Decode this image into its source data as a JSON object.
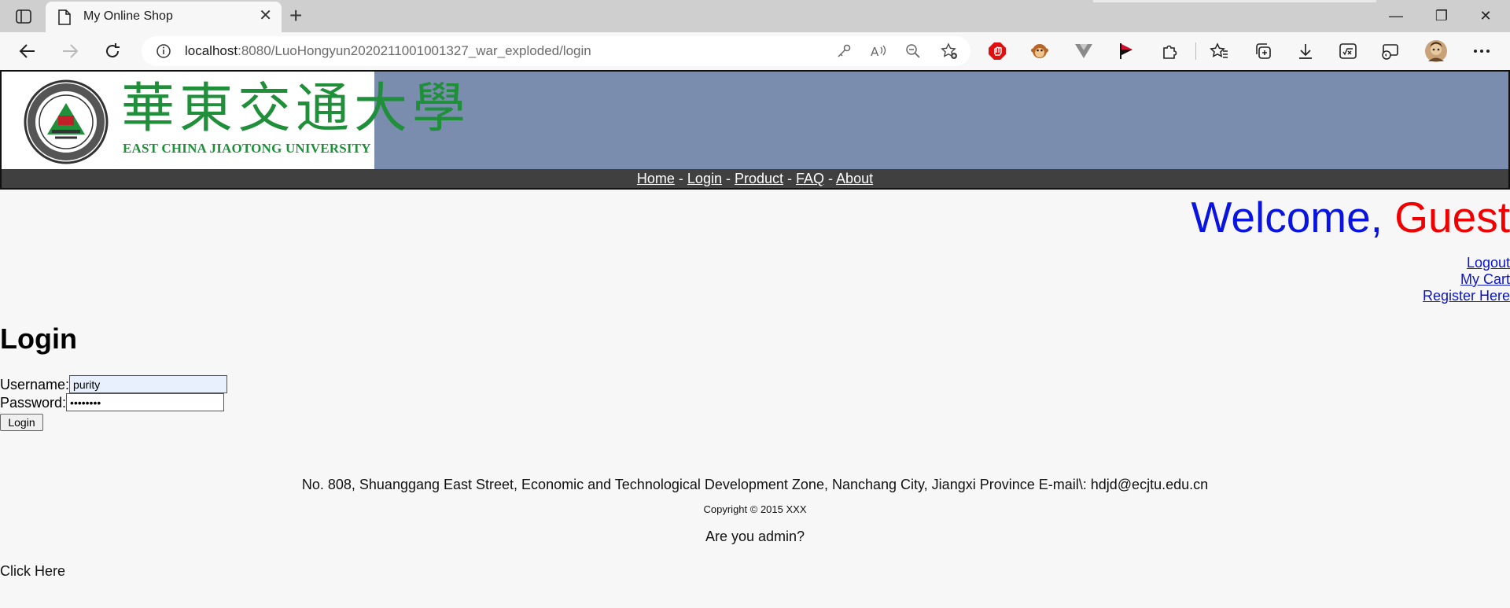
{
  "browser": {
    "tab_title": "My Online Shop",
    "tab_close": "✕",
    "new_tab": "+",
    "url_host": "localhost",
    "url_rest": ":8080/LuoHongyun2020211001001327_war_exploded/login",
    "window_controls": {
      "minimize": "—",
      "restore": "❐",
      "close": "✕"
    }
  },
  "header": {
    "logo_cn": "華東交通大學",
    "logo_en": "EAST CHINA JIAOTONG UNIVERSITY"
  },
  "menu": {
    "items": [
      {
        "label": "Home"
      },
      {
        "label": "Login"
      },
      {
        "label": "Product"
      },
      {
        "label": "FAQ"
      },
      {
        "label": "About"
      }
    ],
    "separator": " - "
  },
  "welcome": {
    "prefix": "Welcome, ",
    "user": "Guest"
  },
  "side_links": {
    "logout": "Logout",
    "cart": "My Cart",
    "register": "Register Here"
  },
  "login": {
    "heading": "Login",
    "username_label": "Username:",
    "username_value": "purity",
    "password_label": "Password:",
    "password_value": "••••••••",
    "button_label": "Login"
  },
  "footer": {
    "address": "No. 808, Shuanggang East Street, Economic and Technological Development Zone, Nanchang City, Jiangxi Province E-mail\\: hdjd@ecjtu.edu.cn",
    "copyright": "Copyright © 2015 XXX",
    "admin_prompt": "Are you admin?",
    "click_here": "Click Here"
  },
  "colors": {
    "banner_bg": "#7a8daf",
    "menubar_bg": "#404040",
    "welcome_blue": "#0a14e0",
    "welcome_red": "#f00000",
    "link_blue": "#0a14c8",
    "logo_green": "#1f8f3a"
  }
}
